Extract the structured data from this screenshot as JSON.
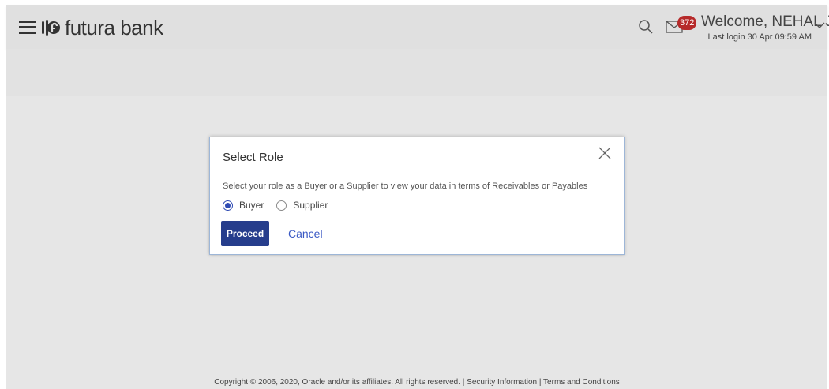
{
  "header": {
    "brand": "futura bank",
    "badge_count": "372",
    "welcome": "Welcome, NEHAL JOSHI",
    "last_login": "Last login 30 Apr 09:59 AM"
  },
  "icons": {
    "menu": "hamburger-menu-icon",
    "logo": "futura-logo-icon",
    "search": "search-icon",
    "mail": "mail-icon",
    "chevron": "chevron-down-icon",
    "close": "close-icon"
  },
  "colors": {
    "primary_button": "#263d8c",
    "badge": "#b62a2a",
    "link": "#3a59c4",
    "radio_selected": "#2f4bb3"
  },
  "modal": {
    "title": "Select Role",
    "description": "Select your role as a Buyer or a Supplier to view your data in terms of Receivables or Payables",
    "options": [
      {
        "label": "Buyer",
        "selected": true
      },
      {
        "label": "Supplier",
        "selected": false
      }
    ],
    "proceed_label": "Proceed",
    "cancel_label": "Cancel"
  },
  "footer": {
    "text": "Copyright © 2006, 2020, Oracle and/or its affiliates. All rights reserved. | Security Information | Terms and Conditions"
  }
}
